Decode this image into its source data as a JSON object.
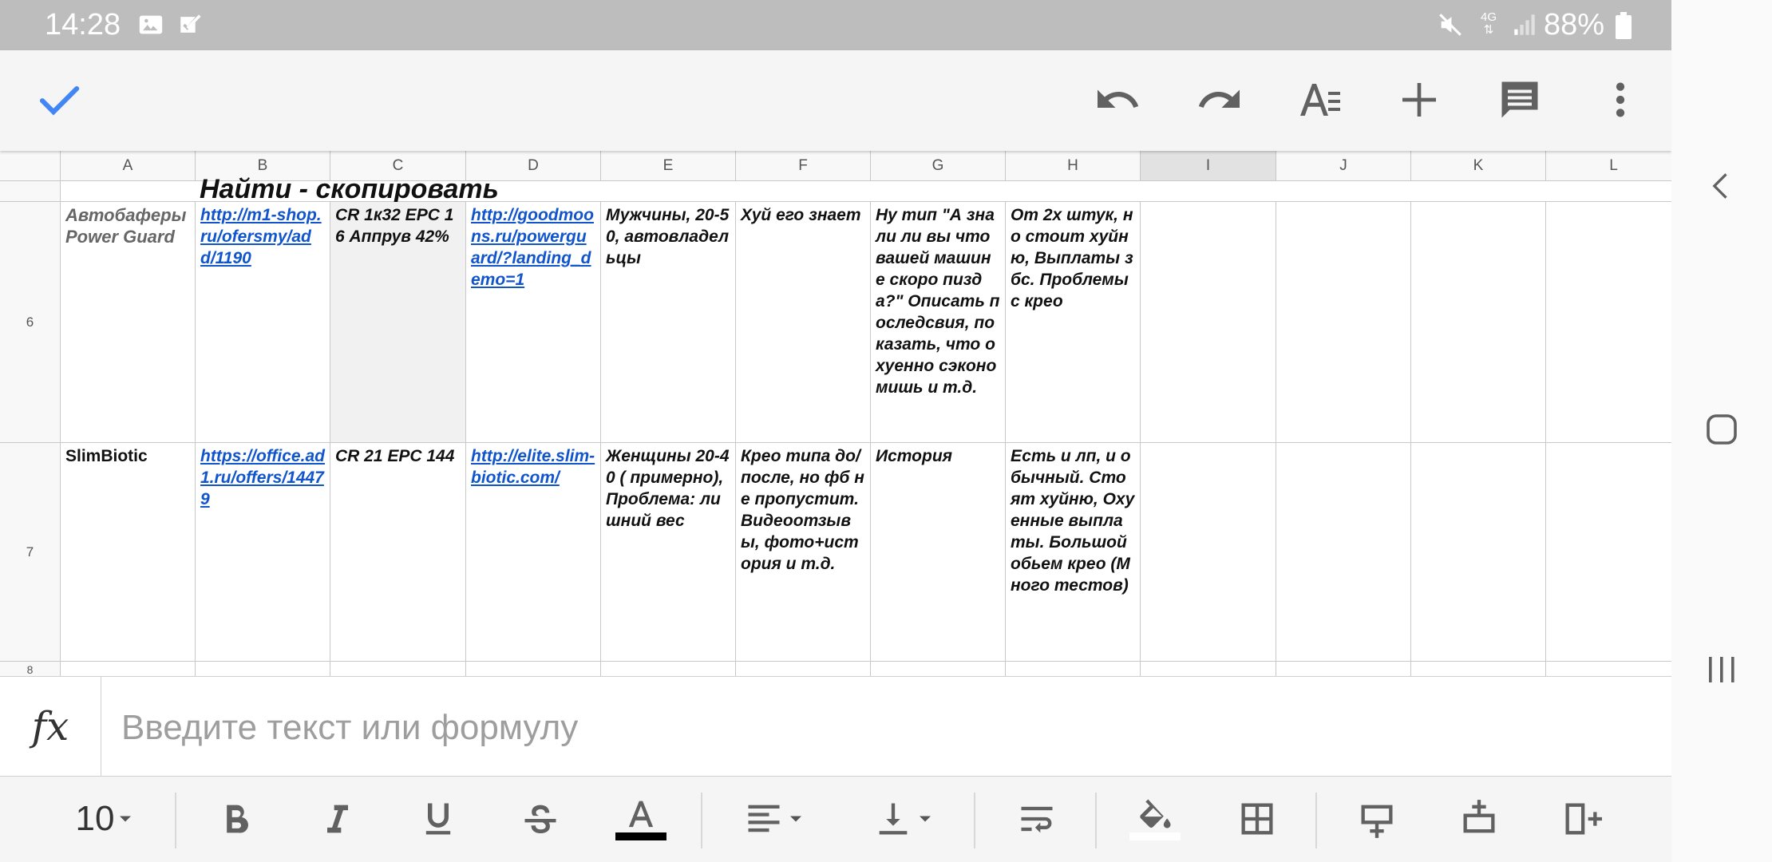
{
  "status_bar": {
    "time": "14:28",
    "network": "4G",
    "battery": "88%",
    "icons": [
      "gallery-icon",
      "check-square-icon",
      "mute-icon",
      "network-arrows-icon",
      "signal-icon",
      "battery-icon"
    ]
  },
  "action_bar": {
    "icons": [
      "check-icon",
      "undo-icon",
      "redo-icon",
      "text-format-icon",
      "add-icon",
      "comment-icon",
      "more-vert-icon"
    ],
    "accent": "#4285f4"
  },
  "sheet": {
    "columns": [
      "A",
      "B",
      "C",
      "D",
      "E",
      "F",
      "G",
      "H",
      "I",
      "J",
      "K",
      "L"
    ],
    "selected_column": "I",
    "partial_row_title": "Найти - скопировать",
    "rows": [
      {
        "number": "6",
        "cells": {
          "A": "Автобаферы Power Guard",
          "B": "http://m1-shop.ru/ofersmy/add/1190",
          "C": "CR 1к32 EPC 16 Аппрув 42%",
          "D": "http://goodmoons.ru/powerguard/?landing_demo=1",
          "E": "Мужчины, 20-50, автовладельцы",
          "F": "Хуй его знает",
          "G": "Ну тип \"А знали ли вы что вашей машине скоро пизда?\" Описать последсвия, показать, что охуенно сэкономишь и т.д.",
          "H": "От 2х штук, но стоит хуйню, Выплаты збс. Проблемы с крео"
        }
      },
      {
        "number": "7",
        "cells": {
          "A": "SlimBiotic",
          "B": "https://office.ad1.ru/offers/14479",
          "C": "CR 21 EPC 144",
          "D": "http://elite.slim-biotic.com/",
          "E": "Женщины 20-40 ( примерно), Проблема: лишний вес",
          "F": "Крео типа до/после, но фб не пропустит. Видеоотзывы, фото+история и т.д.",
          "G": "История",
          "H": "Есть и лп, и обычный. Стоят хуйню, Охуенные выплаты. Большой обьем крео (Много тестов)"
        }
      },
      {
        "number": "8",
        "cells": {}
      }
    ]
  },
  "formula_bar": {
    "fx_label": "fx",
    "placeholder": "Введите текст или формулу",
    "value": ""
  },
  "format_toolbar": {
    "font_size": "10",
    "icons": [
      "bold-icon",
      "italic-icon",
      "underline-icon",
      "strikethrough-icon",
      "text-color-icon",
      "horizontal-align-icon",
      "vertical-align-icon",
      "text-wrap-icon",
      "fill-color-icon",
      "borders-icon",
      "insert-row-below-icon",
      "insert-row-above-icon",
      "insert-column-icon"
    ],
    "text_color": "#000000",
    "fill_color": "#ffffff"
  },
  "nav_bar": {
    "icons": [
      "back-icon",
      "home-icon",
      "recents-icon"
    ]
  }
}
